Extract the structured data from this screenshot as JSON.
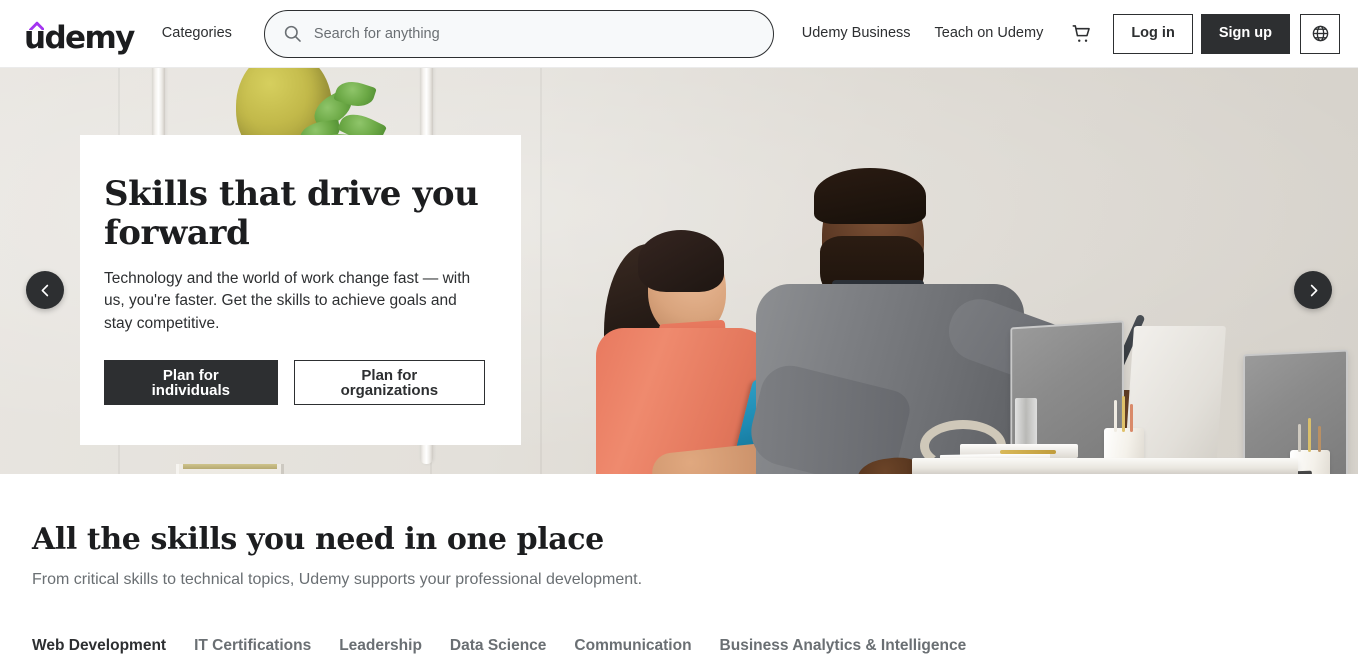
{
  "header": {
    "logo_text": "udemy",
    "logo_accent_color": "#a435f0",
    "categories_label": "Categories",
    "search": {
      "placeholder": "Search for anything",
      "value": "",
      "icon": "search-icon"
    },
    "links": [
      {
        "label": "Udemy Business",
        "name": "udemy-business-link"
      },
      {
        "label": "Teach on Udemy",
        "name": "teach-on-udemy-link"
      }
    ],
    "cart_icon": "shopping-cart-icon",
    "login_label": "Log in",
    "signup_label": "Sign up",
    "language_icon": "globe-icon"
  },
  "hero": {
    "title": "Skills that drive you forward",
    "subtitle": "Technology and the world of work change fast — with us, you're faster. Get the skills to achieve goals and stay competitive.",
    "primary_cta": "Plan for individuals",
    "secondary_cta": "Plan for organizations",
    "prev_icon": "chevron-left-icon",
    "next_icon": "chevron-right-icon"
  },
  "skills": {
    "title": "All the skills you need in one place",
    "subtitle": "From critical skills to technical topics, Udemy supports your professional development.",
    "tabs": [
      {
        "label": "Web Development",
        "active": true
      },
      {
        "label": "IT Certifications",
        "active": false
      },
      {
        "label": "Leadership",
        "active": false
      },
      {
        "label": "Data Science",
        "active": false
      },
      {
        "label": "Communication",
        "active": false
      },
      {
        "label": "Business Analytics & Intelligence",
        "active": false
      }
    ]
  },
  "colors": {
    "brand_purple": "#a435f0",
    "ink": "#1c1d1f",
    "dark_button": "#2d2f31",
    "muted_text": "#6a6f73",
    "search_bg": "#f7f9fa"
  }
}
